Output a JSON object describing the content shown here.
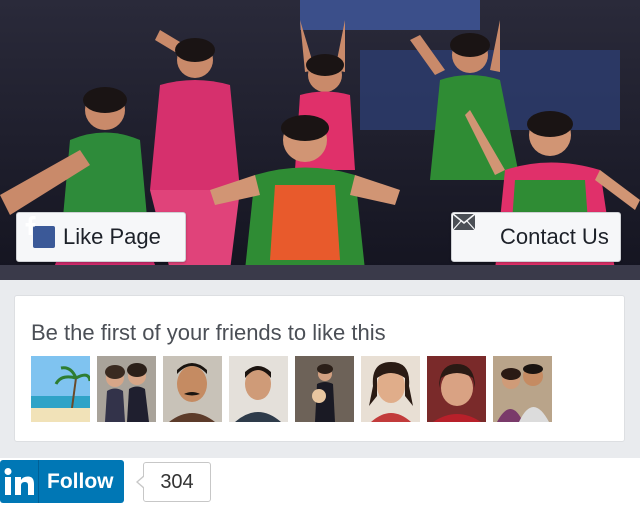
{
  "facebook_widget": {
    "like_button_label": "Like Page",
    "contact_button_label": "Contact Us",
    "friends_text": "Be the first of your friends to like this",
    "friend_avatars": [
      "beach-photo-avatar",
      "two-women-avatar",
      "man-mustache-avatar",
      "young-man-avatar",
      "woman-standing-avatar",
      "woman-portrait-avatar",
      "woman-red-avatar",
      "couple-avatar"
    ],
    "icons": {
      "like": "facebook-icon",
      "contact": "envelope-icon"
    }
  },
  "linkedin": {
    "follow_label": "Follow",
    "follower_count": "304",
    "logo_icon": "linkedin-icon"
  },
  "colors": {
    "facebook_blue": "#3b5998",
    "linkedin_blue": "#0077b5",
    "panel_gray": "#e9ebee"
  }
}
